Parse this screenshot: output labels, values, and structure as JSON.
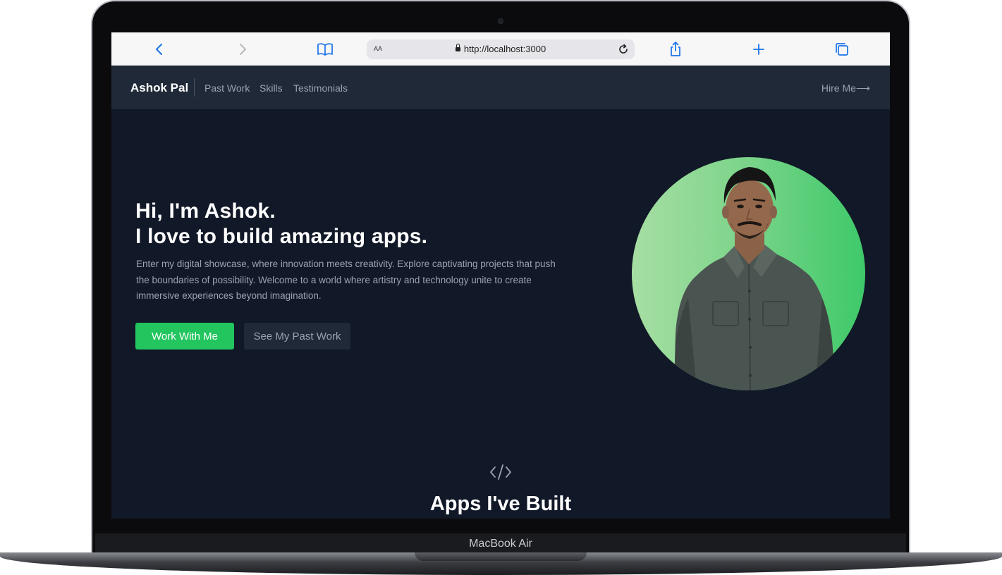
{
  "device": {
    "model": "MacBook Air"
  },
  "browser": {
    "url": "http://localhost:3000",
    "aa_label": "AA",
    "icons": [
      "chevron-left-icon",
      "chevron-right-icon",
      "book-icon",
      "lock-icon",
      "reload-icon",
      "share-icon",
      "plus-icon",
      "tabs-icon"
    ]
  },
  "nav": {
    "brand": "Ashok Pal",
    "links": [
      "Past Work",
      "Skills",
      "Testimonials"
    ],
    "cta": "Hire Me⟶"
  },
  "hero": {
    "title_line1": "Hi, I'm Ashok.",
    "title_line2": "I love to build amazing apps.",
    "description_line1": "Enter my digital showcase, where innovation meets creativity. Explore captivating projects that push",
    "description_line2": "the boundaries of possibility. Welcome to a world where artistry and technology unite to create",
    "description_line3": "immersive experiences beyond imagination.",
    "primary_button": "Work With Me",
    "secondary_button": "See My Past Work"
  },
  "section": {
    "icon": "code-icon",
    "title": "Apps I've Built"
  },
  "colors": {
    "page_bg": "#111827",
    "nav_bg": "#1f2937",
    "accent": "#22c55e",
    "muted_text": "#9ca3af"
  }
}
